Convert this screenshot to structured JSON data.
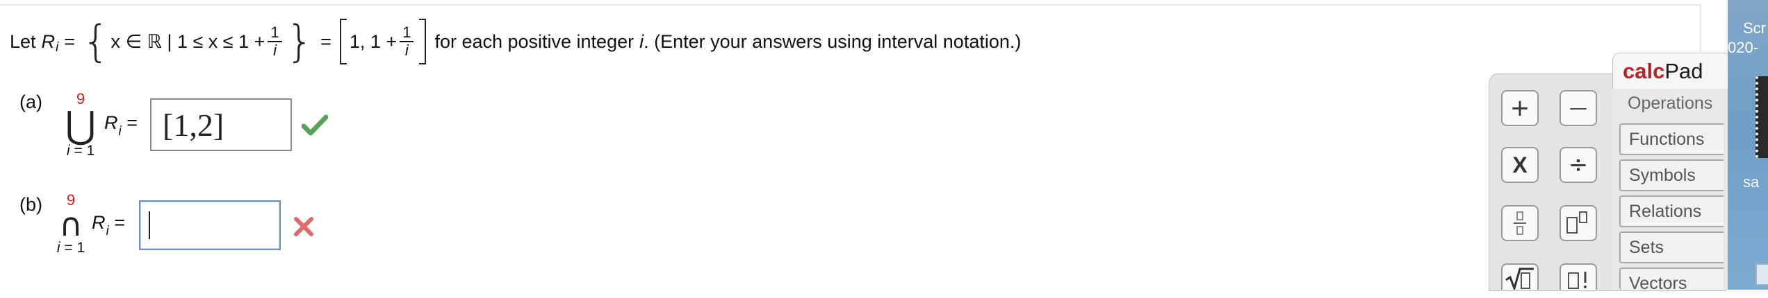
{
  "statement": {
    "let": "Let",
    "set_var": "R",
    "subscript": "i",
    "eq": "=",
    "brace_open": "{",
    "brace_close": "}",
    "set_builder": "x ∈ ℝ | 1 ≤ x ≤ 1 +",
    "frac_num": "1",
    "frac_den": "i",
    "eq2": "=",
    "interval_text": "1, 1 +",
    "frac2_num": "1",
    "frac2_den": "i",
    "tail_a": "for each positive integer",
    "tail_var": "i",
    "tail_b": ". (Enter your answers using interval notation.)"
  },
  "part_a": {
    "label": "(a)",
    "upper": "9",
    "symbol": "⋃",
    "lower_var": "i",
    "lower_rest": "= 1",
    "rel_var": "R",
    "rel_sub": "i",
    "rel_eq": "=",
    "answer_value": "[1,2]",
    "status": "correct"
  },
  "part_b": {
    "label": "(b)",
    "upper": "9",
    "symbol": "∩",
    "lower_var": "i",
    "lower_rest": "= 1",
    "rel_var": "R",
    "rel_sub": "i",
    "rel_eq": "=",
    "answer_value": "",
    "status": "incorrect"
  },
  "calcpad": {
    "brand_bold": "calc",
    "brand_regular": "Pad",
    "keys": {
      "plus": "+",
      "minus": "—",
      "times": "X",
      "divide": "÷"
    },
    "tabs": [
      "Operations",
      "Functions",
      "Symbols",
      "Relations",
      "Sets",
      "Vectors"
    ]
  },
  "desktop": {
    "label_1": "Scr",
    "label_2": "020-",
    "label_3": "sa"
  },
  "colors": {
    "correct": "#5aa05a",
    "incorrect": "#e06a6a",
    "limit_red": "#cc2222",
    "brand_red": "#b3262e"
  }
}
